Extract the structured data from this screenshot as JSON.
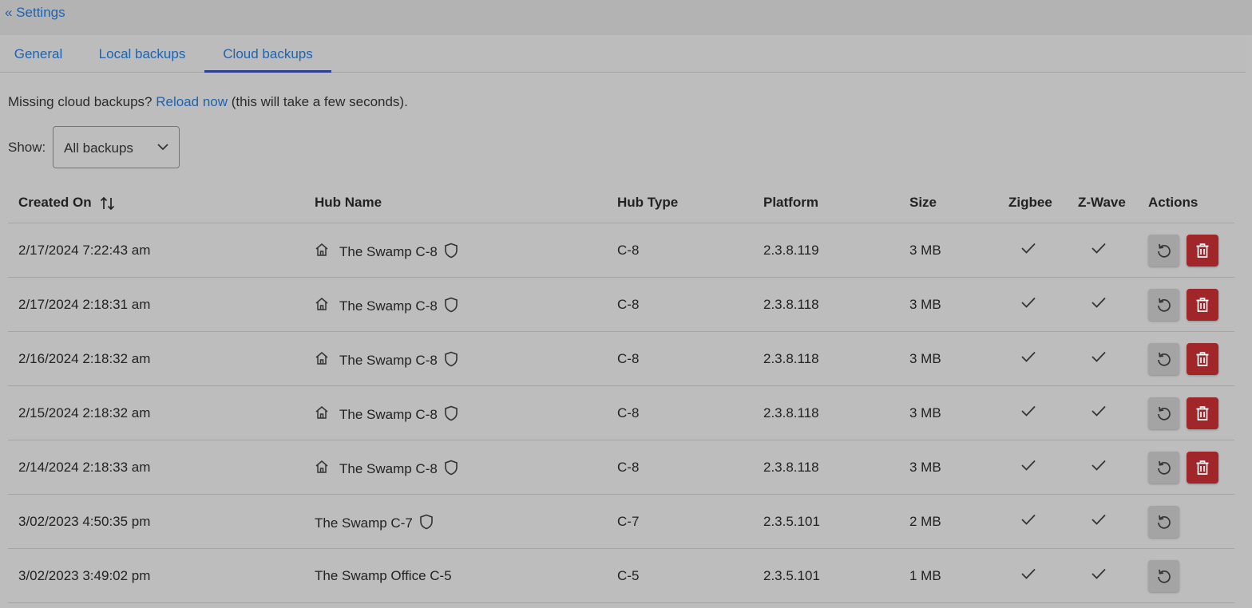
{
  "header": {
    "back_label": "« Settings"
  },
  "tabs": [
    {
      "label": "General",
      "active": false
    },
    {
      "label": "Local backups",
      "active": false
    },
    {
      "label": "Cloud backups",
      "active": true
    }
  ],
  "notice": {
    "prefix": "Missing cloud backups?",
    "link": "Reload now",
    "suffix": "(this will take a few seconds)."
  },
  "filter": {
    "label": "Show:",
    "value": "All backups"
  },
  "table": {
    "columns": [
      "Created On",
      "Hub Name",
      "Hub Type",
      "Platform",
      "Size",
      "Zigbee",
      "Z-Wave",
      "Actions"
    ],
    "rows": [
      {
        "created": "2/17/2024 7:22:43 am",
        "hub": "The Swamp C-8",
        "home": true,
        "shield": true,
        "type": "C-8",
        "platform": "2.3.8.119",
        "size": "3 MB",
        "zigbee": true,
        "zwave": true,
        "deletable": true
      },
      {
        "created": "2/17/2024 2:18:31 am",
        "hub": "The Swamp C-8",
        "home": true,
        "shield": true,
        "type": "C-8",
        "platform": "2.3.8.118",
        "size": "3 MB",
        "zigbee": true,
        "zwave": true,
        "deletable": true
      },
      {
        "created": "2/16/2024 2:18:32 am",
        "hub": "The Swamp C-8",
        "home": true,
        "shield": true,
        "type": "C-8",
        "platform": "2.3.8.118",
        "size": "3 MB",
        "zigbee": true,
        "zwave": true,
        "deletable": true
      },
      {
        "created": "2/15/2024 2:18:32 am",
        "hub": "The Swamp C-8",
        "home": true,
        "shield": true,
        "type": "C-8",
        "platform": "2.3.8.118",
        "size": "3 MB",
        "zigbee": true,
        "zwave": true,
        "deletable": true
      },
      {
        "created": "2/14/2024 2:18:33 am",
        "hub": "The Swamp C-8",
        "home": true,
        "shield": true,
        "type": "C-8",
        "platform": "2.3.8.118",
        "size": "3 MB",
        "zigbee": true,
        "zwave": true,
        "deletable": true
      },
      {
        "created": "3/02/2023 4:50:35 pm",
        "hub": "The Swamp C-7",
        "home": false,
        "shield": true,
        "type": "C-7",
        "platform": "2.3.5.101",
        "size": "2 MB",
        "zigbee": true,
        "zwave": true,
        "deletable": false
      },
      {
        "created": "3/02/2023 3:49:02 pm",
        "hub": "The Swamp Office C-5",
        "home": false,
        "shield": false,
        "type": "C-5",
        "platform": "2.3.5.101",
        "size": "1 MB",
        "zigbee": true,
        "zwave": true,
        "deletable": false
      }
    ]
  },
  "icons": {
    "home": "home-icon",
    "shield": "shield-icon",
    "check": "check-icon",
    "restore": "restore-icon",
    "delete": "trash-icon",
    "sort": "sort-icon",
    "dropdown": "chevron-down-icon"
  },
  "colors": {
    "link": "#1e63b0",
    "tab_indicator": "#2a3d8f",
    "delete": "#a0262a"
  }
}
